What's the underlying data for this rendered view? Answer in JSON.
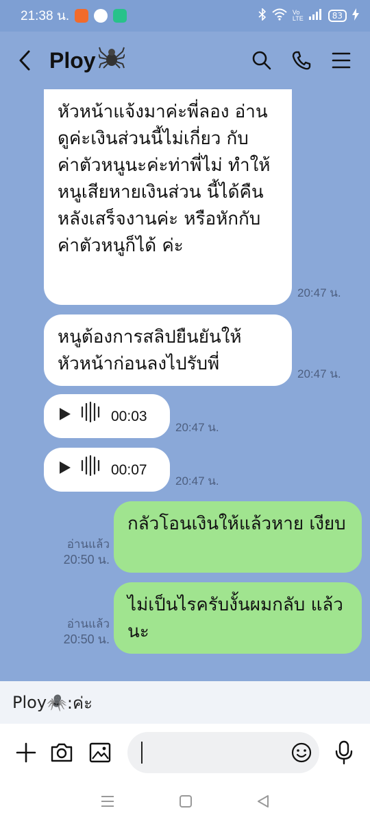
{
  "status": {
    "time": "21:38 น.",
    "battery": "83"
  },
  "header": {
    "title": "Ploy",
    "title_emoji": "🕷️"
  },
  "messages": {
    "m1_text": "หัวหน้าแจ้งมาค่ะพี่ลอง อ่านดูค่ะเงินส่วนนี้ไม่เกี่ยว กับค่าตัวหนูนะค่ะท่าพี่ไม่ ทำให้หนูเสียหายเงินส่วน นี้ได้คืนหลังเสร็จงานค่ะ หรือหักกับค่าตัวหนูก็ได้ ค่ะ",
    "m1_time": "20:47 น.",
    "m2_text": "หนูต้องการสลิปยืนยันให้ หัวหน้าก่อนลงไปรับพี่",
    "m2_time": "20:47 น.",
    "v1_duration": "00:03",
    "v1_time": "20:47 น.",
    "v2_duration": "00:07",
    "v2_time": "20:47 น.",
    "me1_text": "กลัวโอนเงินให้แล้วหาย เงียบ",
    "me1_read": "อ่านแล้ว",
    "me1_time": "20:50 น.",
    "me2_text": "ไม่เป็นไรครับงั้นผมกลับ แล้วนะ",
    "me2_read": "อ่านแล้ว",
    "me2_time": "20:50 น."
  },
  "preview": {
    "sender": "Ploy🕷️",
    "text": ":ค่ะ"
  },
  "colors": {
    "chat_bg": "#8aa8d8",
    "my_bubble": "#a0e48f",
    "their_bubble": "#ffffff"
  },
  "icons": [
    "back-arrow-icon",
    "search-icon",
    "phone-icon",
    "menu-icon",
    "plus-icon",
    "camera-icon",
    "image-icon",
    "emoji-icon",
    "microphone-icon",
    "play-icon",
    "waveform-icon"
  ]
}
